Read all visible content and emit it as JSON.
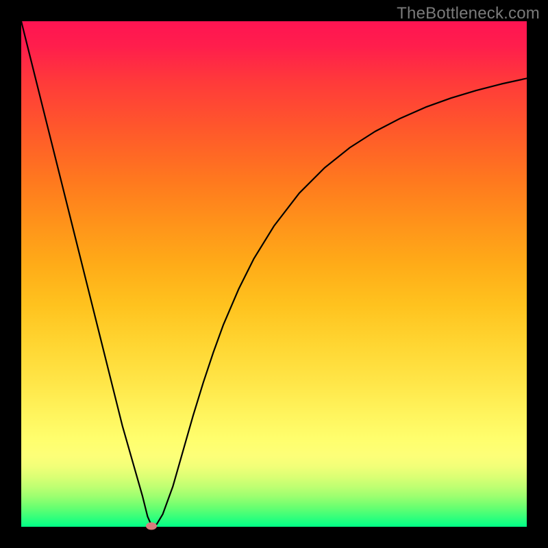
{
  "watermark": "TheBottleneck.com",
  "chart_data": {
    "type": "line",
    "title": "",
    "xlabel": "",
    "ylabel": "",
    "xlim": [
      0,
      100
    ],
    "ylim": [
      0,
      100
    ],
    "grid": false,
    "series": [
      {
        "name": "curve",
        "x": [
          0.0,
          2.0,
          4.0,
          6.0,
          8.0,
          10.0,
          12.0,
          14.0,
          16.0,
          18.0,
          20.0,
          22.0,
          24.0,
          25.0,
          25.8,
          26.8,
          28.0,
          30.0,
          32.0,
          34.0,
          36.0,
          38.0,
          40.0,
          43.0,
          46.0,
          50.0,
          55.0,
          60.0,
          65.0,
          70.0,
          75.0,
          80.0,
          85.0,
          90.0,
          95.0,
          100.0
        ],
        "values": [
          100.0,
          92.0,
          84.0,
          76.0,
          68.0,
          60.0,
          52.0,
          44.0,
          36.0,
          28.0,
          20.0,
          13.0,
          6.0,
          2.0,
          0.2,
          0.5,
          2.5,
          8.0,
          15.0,
          22.0,
          28.5,
          34.5,
          40.0,
          47.0,
          53.0,
          59.5,
          66.0,
          71.0,
          75.0,
          78.2,
          80.8,
          83.0,
          84.8,
          86.3,
          87.6,
          88.7
        ]
      }
    ],
    "marker": {
      "x": 25.8,
      "y": 0.2
    },
    "background_gradient": {
      "top": "#ff1452",
      "bottom": "#00ff86"
    }
  }
}
